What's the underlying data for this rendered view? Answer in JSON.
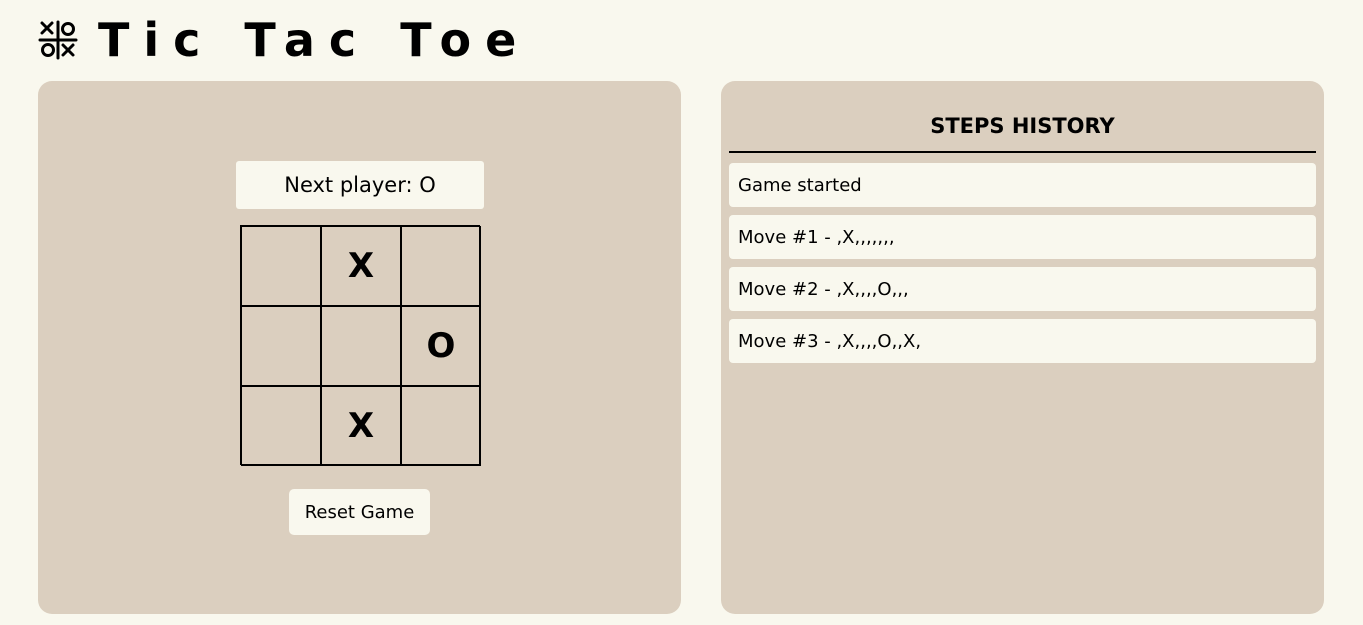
{
  "header": {
    "title": "Tic Tac Toe",
    "logo_icon": "tic-tac-toe-grid-icon"
  },
  "game": {
    "status": "Next player: O",
    "board": [
      "",
      "X",
      "",
      "",
      "",
      "O",
      "",
      "X",
      ""
    ],
    "reset_label": "Reset Game"
  },
  "history": {
    "title": "STEPS HISTORY",
    "items": [
      "Game started",
      "Move #1 - ,X,,,,,,,",
      "Move #2 - ,X,,,,O,,,",
      "Move #3 - ,X,,,,O,,X,"
    ]
  },
  "colors": {
    "background": "#f9f8ee",
    "panel": "#dbcfbf",
    "text": "#000000"
  }
}
